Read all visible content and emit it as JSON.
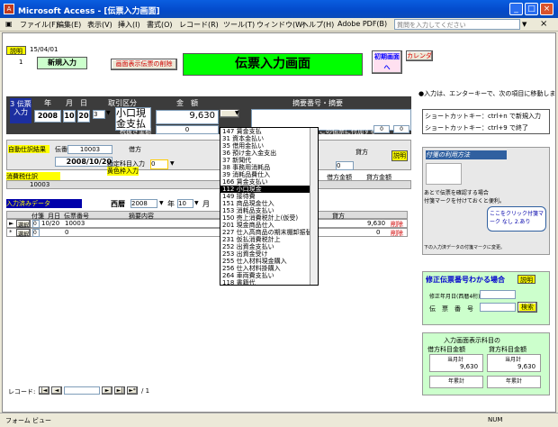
{
  "window": {
    "title": "Microsoft Access - [伝票入力画面]",
    "minimize": "_",
    "maximize": "□",
    "close": "×"
  },
  "menu": {
    "items": [
      "ファイル(F)",
      "編集(E)",
      "表示(V)",
      "挿入(I)",
      "書式(O)",
      "レコード(R)",
      "ツール(T)",
      "ウィンドウ(W)",
      "ヘルプ(H)",
      "Adobe PDF(B)"
    ],
    "help_placeholder": "質問を入力してください",
    "mdi_close": "×"
  },
  "top": {
    "setsumei": "説明",
    "date": "15/04/01",
    "num": "1",
    "new_input": "新規入力",
    "show_delete": "画面表示伝票の削除",
    "title": "伝票入力画面",
    "init_screen": "初期画面へ",
    "calendar": "カレンダ"
  },
  "slip": {
    "label": "3 伝票入力",
    "year_h": "年",
    "month_h": "月",
    "day_h": "日",
    "kind_h": "取引区分",
    "amount_h": "金　額",
    "summary_h": "摘要番号・摘要",
    "year": "2008",
    "month": "10",
    "day": "20",
    "kind_num": "3",
    "kind_text": "小口現金支払",
    "amount": "9,630",
    "tax_label": "税抜き金額",
    "tax_val": "0",
    "conv_label": "この伝票に付加する",
    "conv_val": "0",
    "conv_val2": "0"
  },
  "auto": {
    "title": "自動仕訳結果",
    "slip_no_label": "伝番",
    "slip_no": "10003",
    "date": "2008/10/20",
    "debit_label": "借方",
    "code_label": "勘定科目入力",
    "color_label": "黄色枠入力",
    "setsumei": "説明",
    "credit_label": "貸方",
    "debit_code": "0",
    "credit_code": "0"
  },
  "tax": {
    "title": "消費税仕訳",
    "val": "10003",
    "debit_label": "借方金額",
    "credit_label": "貸方金額"
  },
  "entered": {
    "title": "入力済みデータ",
    "era": "西暦",
    "year": "2008",
    "year_unit": "年",
    "month": "10",
    "month_unit": "月",
    "day_unit": "日"
  },
  "grid": {
    "headers": [
      "付箋",
      "月日",
      "伝票番号",
      "摘要内容",
      "貸方"
    ],
    "rows": [
      {
        "tag": "選択",
        "sel": "0",
        "date": "10/20",
        "no": "10003",
        "amount": "9,630",
        "action": "削除"
      },
      {
        "tag": "選択",
        "sel": "0",
        "date": "",
        "no": "0",
        "amount": "0",
        "action": "削除"
      }
    ]
  },
  "dropdown": {
    "items": [
      "147 賃金支払",
      "31 資本金払い",
      "35 借用金払い",
      "36 預け金入金支出",
      "37 新聞代",
      "38 事務用消耗品",
      "39 消耗品費仕入",
      "166 賃金支払い",
      "112 小口現金",
      "149 接待費",
      "151 商品現金仕入",
      "153 消耗品支払い",
      "150 売上消費税計上(仮受)",
      "201 現金商品仕入",
      "227 仕入高商品の期末棚卸振替",
      "231 仮払消費税計上",
      "252 出資金支払い",
      "253 出資金受け",
      "255 仕入材料現金購入",
      "256 仕入材料掛購入",
      "264 車両費支払い",
      "118 書籍代"
    ],
    "selected_index": 8
  },
  "right": {
    "note": "●入力は、エンターキーで、次の項目に移動します",
    "shortcut1": "ショートカットキー：ctrl+n で新規入力",
    "shortcut2": "ショートカットキー：ctrl+9 で終了",
    "tag_title": "付箋の利用方法",
    "tag_note1": "あとで伝票を確認する場合",
    "tag_note2": "付箋マークを付けておくと便利。",
    "tag_bubble": "ここをクリック付箋マーク なし 2.あり",
    "tag_footer": "下の入力済データの付箋マークに変更。"
  },
  "fix": {
    "title": "修正伝票番号わかる場合",
    "setsumei": "説明",
    "date_label": "修正年月日(西暦4桁)",
    "no_label": "伝　票　番　号",
    "search": "検索"
  },
  "summary": {
    "title": "入力画面表示科目の",
    "debit": "借方科目金額",
    "credit": "貸方科目金額",
    "month_debit": "当月計",
    "month_credit": "当月計",
    "debit_val": "9,630",
    "credit_val": "9,630",
    "year_debit": "年累計",
    "year_credit": "年累計"
  },
  "record": {
    "label": "レコード:",
    "first": "|◄",
    "prev": "◄",
    "next": "►",
    "last": "►|",
    "new": "►*",
    "value": "",
    "of": "/ 1"
  },
  "status": {
    "left": "フォーム ビュー",
    "right": "NUM"
  }
}
